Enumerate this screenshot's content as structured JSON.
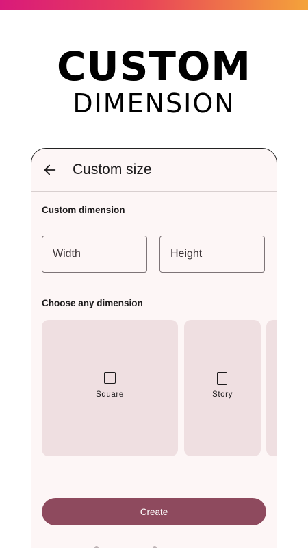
{
  "promo": {
    "title": "CUSTOM",
    "subtitle": "DIMENSION"
  },
  "app_bar": {
    "back_icon": "arrow-left-icon",
    "title": "Custom size"
  },
  "custom_dimension": {
    "label": "Custom dimension",
    "width_placeholder": "Width",
    "height_placeholder": "Height"
  },
  "choose_dimension": {
    "label": "Choose any dimension",
    "options": [
      {
        "label": "Square",
        "icon": "square-icon"
      },
      {
        "label": "Story",
        "icon": "story-portrait-icon"
      }
    ]
  },
  "actions": {
    "create_label": "Create"
  },
  "colors": {
    "accent": "#8e4a5e",
    "card_bg": "#efdfe1",
    "surface": "#fdf6f6",
    "gradient_start": "#d91a7a",
    "gradient_end": "#f4a33a"
  }
}
